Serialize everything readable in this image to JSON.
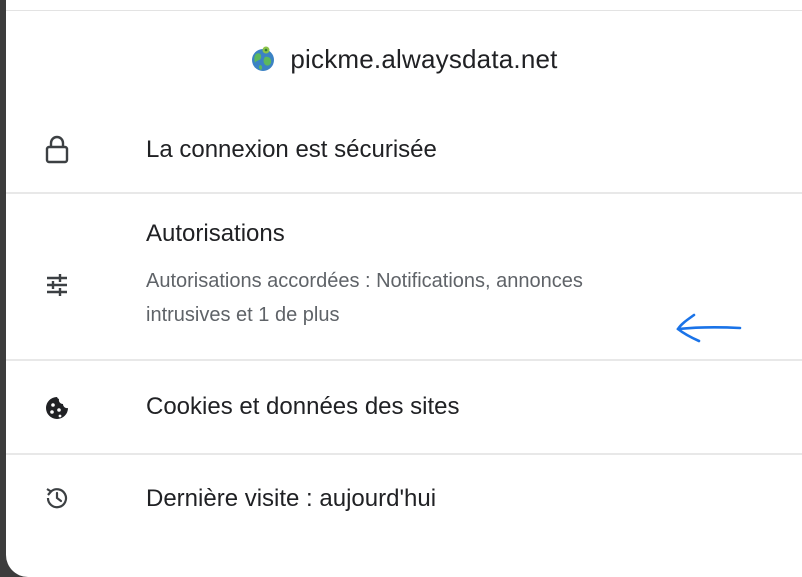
{
  "header": {
    "site_icon": "globe-earth-icon",
    "domain": "pickme.alwaysdata.net"
  },
  "rows": [
    {
      "icon": "lock-icon",
      "title": "La connexion est sécurisée"
    },
    {
      "icon": "tune-sliders-icon",
      "title": "Autorisations",
      "subtitle_line1": "Autorisations accordées : Notifications, annonces",
      "subtitle_line2": "intrusives et 1 de plus"
    },
    {
      "icon": "cookie-icon",
      "title": "Cookies et données des sites"
    },
    {
      "icon": "history-icon",
      "title": "Dernière visite : aujourd'hui"
    }
  ],
  "annotation": {
    "type": "hand-drawn-arrow-left",
    "color": "#1a73e8"
  }
}
